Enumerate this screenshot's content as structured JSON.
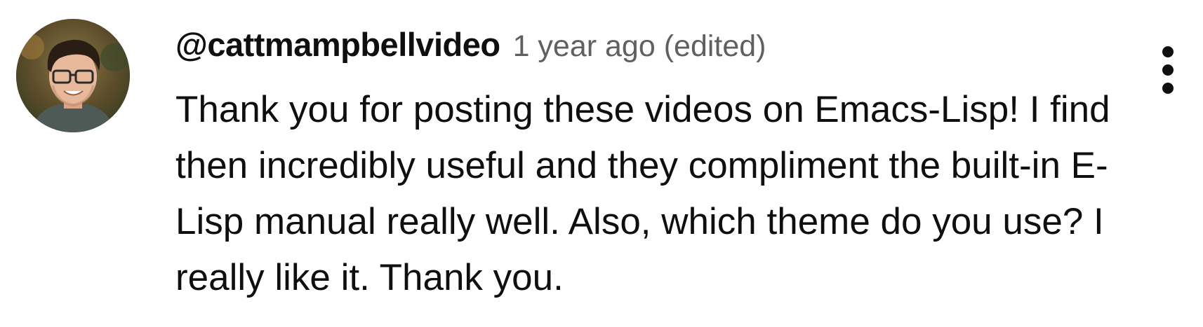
{
  "comment": {
    "author": "@cattmampbellvideo",
    "time": "1 year ago (edited)",
    "text": "Thank you for posting these videos on Emacs-Lisp! I find then incredibly useful and they compliment the built-in E-Lisp manual really well. Also, which theme do you use? I really like it. Thank you."
  },
  "icons": {
    "avatar": "avatar",
    "more": "more-vert-icon"
  },
  "colors": {
    "text": "#0f0f0f",
    "secondary_text": "#606060",
    "background": "#ffffff"
  }
}
